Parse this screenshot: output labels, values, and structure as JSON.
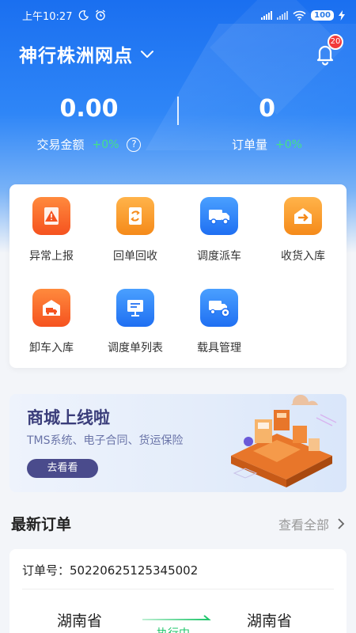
{
  "status_bar": {
    "time": "上午10:27",
    "battery": "100"
  },
  "header": {
    "station": "神行株洲网点",
    "notification_count": "20"
  },
  "stats": {
    "left": {
      "value": "0.00",
      "label": "交易金额",
      "change": "+0%"
    },
    "right": {
      "value": "0",
      "label": "订单量",
      "change": "+0%"
    }
  },
  "grid": {
    "items": [
      {
        "label": "异常上报",
        "icon": "warning-icon"
      },
      {
        "label": "回单回收",
        "icon": "receipt-recycle-icon"
      },
      {
        "label": "调度派车",
        "icon": "truck-icon"
      },
      {
        "label": "收货入库",
        "icon": "warehouse-in-icon"
      },
      {
        "label": "卸车入库",
        "icon": "unload-truck-icon"
      },
      {
        "label": "调度单列表",
        "icon": "dispatch-list-icon"
      },
      {
        "label": "载具管理",
        "icon": "vehicle-settings-icon"
      }
    ]
  },
  "banner": {
    "title": "商城上线啦",
    "subtitle": "TMS系统、电子合同、货运保险",
    "button": "去看看"
  },
  "latest_orders": {
    "title": "最新订单",
    "view_all": "查看全部",
    "order": {
      "number_label": "订单号：",
      "number": "50220625125345002",
      "from": "湖南省",
      "to": "湖南省",
      "status": "执行中"
    }
  },
  "colors": {
    "primary": "#1a6ff0",
    "positive": "#44e08a",
    "badge": "#f23a3a",
    "orange_tile": "#f5521f",
    "blue_tile": "#1f6ff2",
    "banner_button": "#4a4b8c"
  }
}
